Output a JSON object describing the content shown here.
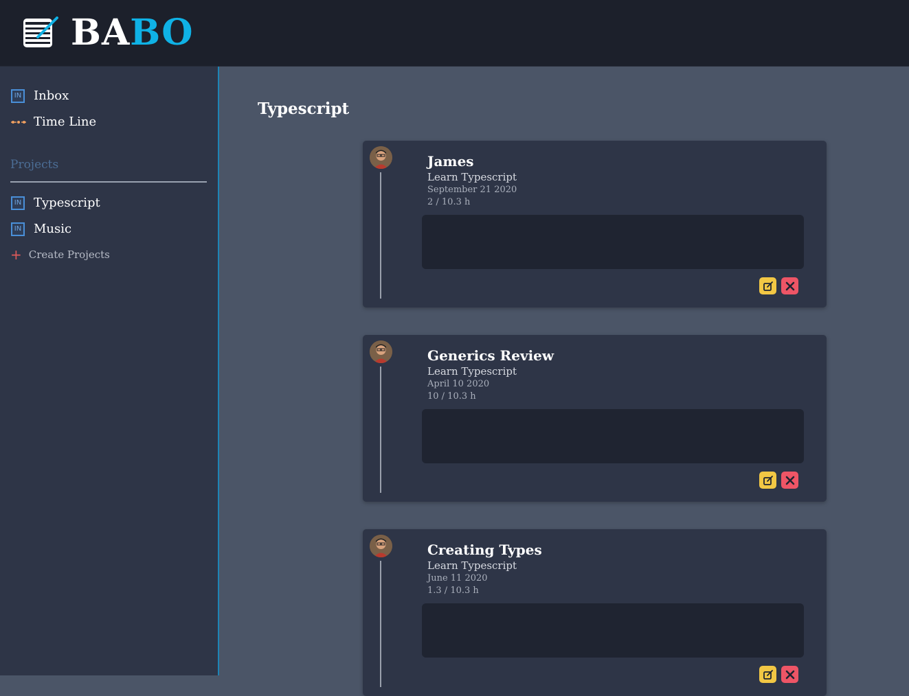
{
  "brand": {
    "part1": "BA",
    "part2": "BO",
    "accent": "#0fb2e6"
  },
  "sidebar": {
    "nav": [
      {
        "label": "Inbox",
        "icon": "inbox-icon"
      },
      {
        "label": "Time Line",
        "icon": "timeline-dots-icon"
      }
    ],
    "projects_label": "Projects",
    "projects": [
      {
        "label": "Typescript",
        "icon": "project-icon"
      },
      {
        "label": "Music",
        "icon": "project-icon"
      }
    ],
    "create_label": "Create Projects"
  },
  "main": {
    "title": "Typescript",
    "cards": [
      {
        "title": "James",
        "project": "Learn Typescript",
        "date": "September 21 2020",
        "hours": "2 / 10.3 h"
      },
      {
        "title": "Generics Review",
        "project": "Learn Typescript",
        "date": "April 10 2020",
        "hours": "10 / 10.3 h"
      },
      {
        "title": "Creating Types",
        "project": "Learn Typescript",
        "date": "June 11 2020",
        "hours": "1.3 / 10.3 h"
      }
    ]
  },
  "colors": {
    "header_bg": "#1c202b",
    "sidebar_bg": "#2e3547",
    "main_bg": "#4b5567",
    "edit_button": "#f2c744",
    "delete_button": "#ee5566"
  }
}
